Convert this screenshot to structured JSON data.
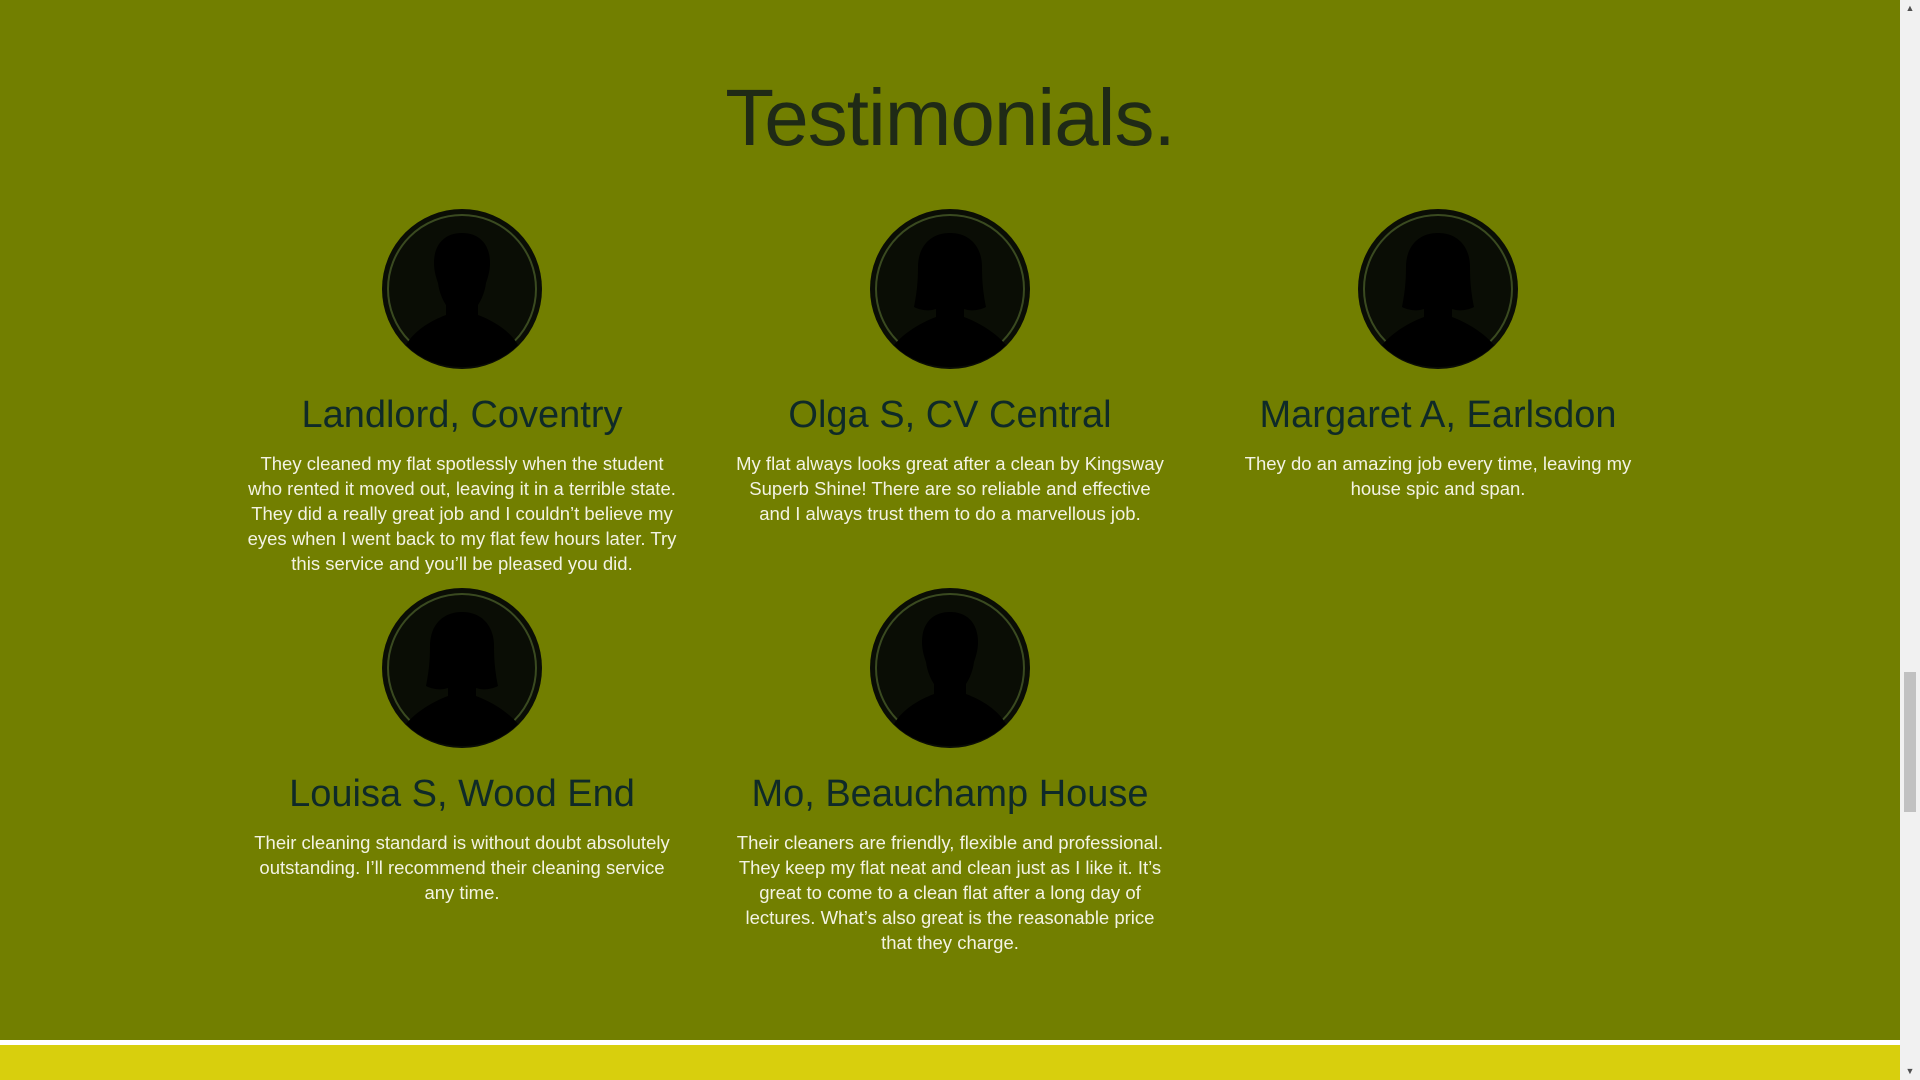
{
  "section": {
    "title": "Testimonials."
  },
  "testimonials": [
    {
      "name": "Landlord, Coventry",
      "text": "They cleaned my flat spotlessly when the student who rented it moved out, leaving it in a terrible state. They did a really great job and I couldn’t believe my eyes when I went back to my flat few hours later. Try this service and you’ll be pleased you did.",
      "avatar": "male-avatar-icon"
    },
    {
      "name": "Olga S, CV Central",
      "text": "My flat always looks great after a clean by Kingsway Superb Shine! There are so reliable and effective and I always trust them to do a marvellous job.",
      "avatar": "female-avatar-icon"
    },
    {
      "name": "Margaret A, Earlsdon",
      "text": "They do an amazing job every time, leaving my house spic and span.",
      "avatar": "female-avatar-icon"
    },
    {
      "name": "Louisa S, Wood End",
      "text": "Their cleaning standard is without doubt absolutely outstanding. I’ll recommend their cleaning service any time.",
      "avatar": "female-avatar-icon"
    },
    {
      "name": "Mo, Beauchamp House",
      "text": "Their cleaners are friendly, flexible and professional. They keep my flat neat and clean just as I like it. It’s great to come to a clean flat after a long day of lectures. What’s also great is the reasonable price that they charge.",
      "avatar": "male-avatar-icon"
    }
  ],
  "colors": {
    "section_background": "#727f00",
    "name_text": "#0f2a28",
    "quote_text": "#f3f3e3",
    "footer_band": "#d8cf0d"
  },
  "scrollbar": {
    "up_icon": "scroll-up-arrow-icon",
    "down_icon": "scroll-down-arrow-icon"
  }
}
